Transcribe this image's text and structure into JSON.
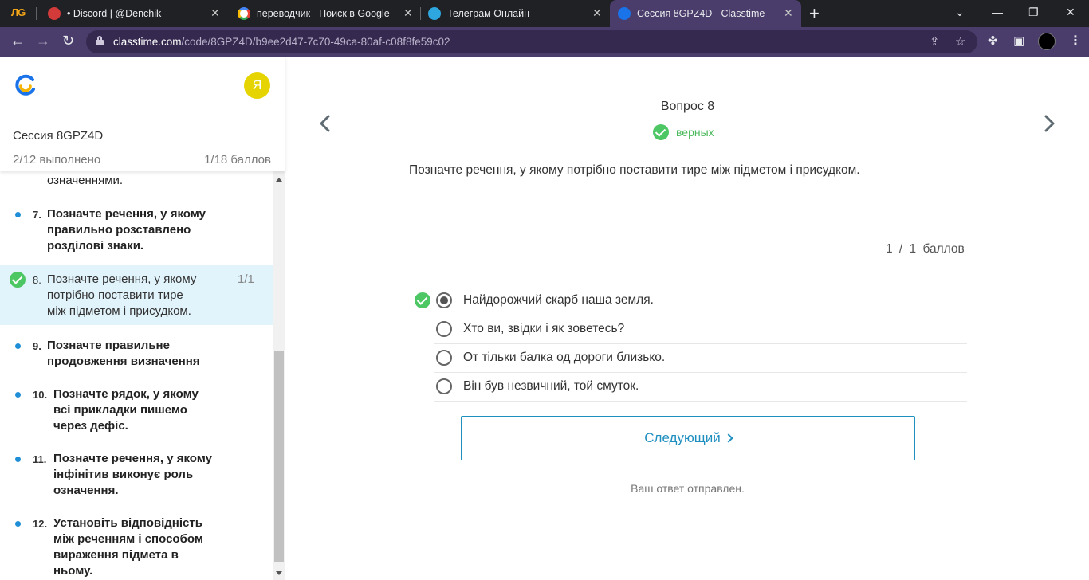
{
  "browser": {
    "extension_label": "ЛG",
    "tabs": [
      {
        "title": "• Discord | @Denchik",
        "active": false
      },
      {
        "title": "переводчик - Поиск в Google",
        "active": false
      },
      {
        "title": "Телеграм Онлайн",
        "active": false
      },
      {
        "title": "Сессия 8GPZ4D - Classtime",
        "active": true
      }
    ],
    "url_host": "classtime.com",
    "url_path": "/code/8GPZ4D/b9ee2d47-7c70-49ca-80af-c08f8fe59c02",
    "icons": [
      "back-icon",
      "forward-icon",
      "reload-icon",
      "lock-icon",
      "share-icon",
      "star-icon",
      "extensions-icon",
      "sidepanel-icon",
      "profile-icon",
      "menu-icon"
    ]
  },
  "sidebar": {
    "avatar_letter": "Я",
    "session_title": "Сессия 8GPZ4D",
    "progress_done": "2/12 выполнено",
    "progress_score": "1/18 баллов",
    "items": [
      {
        "num": "",
        "lines": [
          "",
          "означеннями."
        ],
        "state": "partial"
      },
      {
        "num": "7.",
        "lines": [
          "Позначте речення, у якому",
          "правильно розставлено",
          "розділові знаки."
        ],
        "state": "todo"
      },
      {
        "num": "8.",
        "lines": [
          "Позначте речення, у якому",
          "потрібно поставити тире",
          "між підметом і присудком."
        ],
        "state": "current",
        "score": "1/1"
      },
      {
        "num": "9.",
        "lines": [
          "Позначте правильне",
          "продовження визначення"
        ],
        "state": "todo"
      },
      {
        "num": "10.",
        "lines": [
          "Позначте рядок, у якому",
          "всі прикладки пишемо",
          "через дефіс."
        ],
        "state": "todo"
      },
      {
        "num": "11.",
        "lines": [
          "Позначте речення, у якому",
          "інфінітив виконує роль",
          "означення."
        ],
        "state": "todo"
      },
      {
        "num": "12.",
        "lines": [
          "Установіть відповідність",
          "між реченням і способом",
          "вираження підмета в",
          "ньому."
        ],
        "state": "todo"
      }
    ]
  },
  "main": {
    "question_label": "Вопрос 8",
    "status_text": "верных",
    "question_text": "Позначте речення, у якому потрібно поставити тире між підметом і присудком.",
    "points": "1 / 1 баллов",
    "options": [
      {
        "text": "Найдорожчий скарб наша земля.",
        "selected": true,
        "correct": true
      },
      {
        "text": "Хто ви, звідки і як зоветесь?",
        "selected": false,
        "correct": false
      },
      {
        "text": "От тільки балка од дороги близько.",
        "selected": false,
        "correct": false
      },
      {
        "text": "Він був незвичний, той смуток.",
        "selected": false,
        "correct": false
      }
    ],
    "next_button": "Следующий",
    "submitted_text": "Ваш ответ отправлен."
  },
  "colors": {
    "accent": "#1f8fbf",
    "success": "#4cc764",
    "browser_frame": "#4a3c6b",
    "current_item_bg": "#e1f3fb",
    "avatar_bg": "#e6d400"
  }
}
